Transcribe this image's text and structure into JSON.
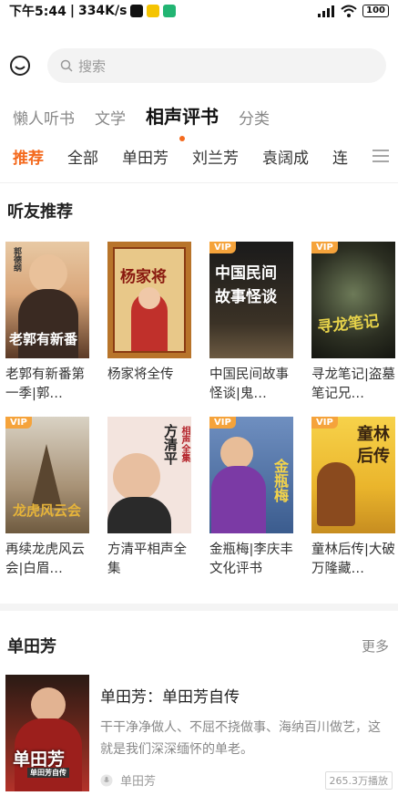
{
  "status_bar": {
    "time": "下午5:44",
    "speed": "334K/s",
    "battery": "100",
    "signal": "HD"
  },
  "search": {
    "placeholder": "搜索"
  },
  "top_tabs": [
    {
      "label": "懒人听书",
      "active": false
    },
    {
      "label": "文学",
      "active": false
    },
    {
      "label": "相声评书",
      "active": true
    },
    {
      "label": "分类",
      "active": false
    }
  ],
  "category_tabs": [
    {
      "label": "推荐",
      "active": true
    },
    {
      "label": "全部",
      "active": false
    },
    {
      "label": "单田芳",
      "active": false
    },
    {
      "label": "刘兰芳",
      "active": false
    },
    {
      "label": "袁阔成",
      "active": false
    },
    {
      "label": "连",
      "active": false
    }
  ],
  "recommend": {
    "title": "听友推荐",
    "books": [
      {
        "title": "老郭有新番第一季|郭…",
        "vip": false,
        "cover_text": "老郭有新番",
        "cover_sub": "郭德纲"
      },
      {
        "title": "杨家将全传",
        "vip": false,
        "cover_text": "杨家将",
        "cover_sub": ""
      },
      {
        "title": "中国民间故事怪谈|鬼…",
        "vip": true,
        "cover_text": "中国民间故事怪谈",
        "cover_sub": ""
      },
      {
        "title": "寻龙笔记|盗墓笔记兄…",
        "vip": true,
        "cover_text": "寻龙笔记",
        "cover_sub": ""
      },
      {
        "title": "再续龙虎风云会|白眉…",
        "vip": true,
        "cover_text": "龙虎风云会",
        "cover_sub": ""
      },
      {
        "title": "方清平相声全集",
        "vip": false,
        "cover_text": "方清平",
        "cover_sub": "相声全集"
      },
      {
        "title": "金瓶梅|李庆丰文化评书",
        "vip": true,
        "cover_text": "金瓶梅",
        "cover_sub": ""
      },
      {
        "title": "童林后传|大破万隆藏…",
        "vip": true,
        "cover_text": "童林后传",
        "cover_sub": ""
      }
    ],
    "vip_label": "VIP"
  },
  "shantianfang": {
    "title": "单田芳",
    "more": "更多",
    "item": {
      "title": "单田芳：单田芳自传",
      "desc": "干干净净做人、不屈不挠做事、海纳百川做艺，这就是我们深深缅怀的单老。",
      "author": "单田芳",
      "plays": "265.3万播放",
      "cover_text": "单田芳",
      "cover_sub": "单田芳自传"
    }
  },
  "colors": {
    "accent": "#f46a1e",
    "vip": "#f5a33b"
  }
}
